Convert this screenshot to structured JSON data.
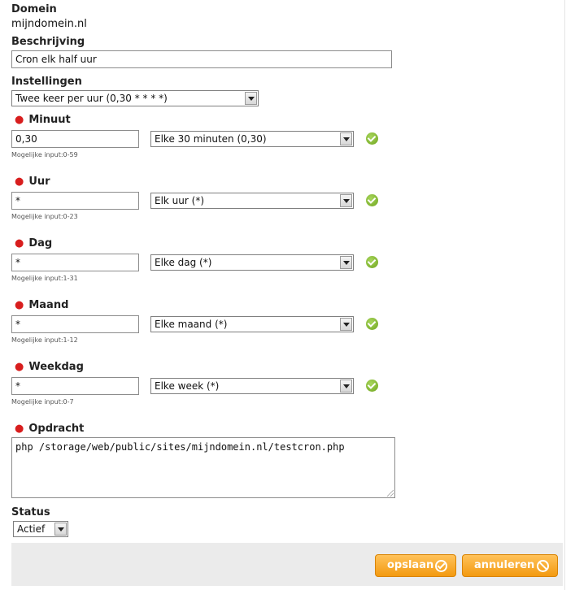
{
  "domain": {
    "label": "Domein",
    "value": "mijndomein.nl"
  },
  "description": {
    "label": "Beschrijving",
    "value": "Cron elk half uur"
  },
  "settings": {
    "label": "Instellingen",
    "selected": "Twee keer per uur (0,30 * * * *)"
  },
  "fields": [
    {
      "label": "Minuut",
      "value": "0,30",
      "option": "Elke 30 minuten (0,30)",
      "hint": "Mogelijke input:0-59"
    },
    {
      "label": "Uur",
      "value": "*",
      "option": "Elk uur (*)",
      "hint": "Mogelijke input:0-23"
    },
    {
      "label": "Dag",
      "value": "*",
      "option": "Elke dag (*)",
      "hint": "Mogelijke input:1-31"
    },
    {
      "label": "Maand",
      "value": "*",
      "option": "Elke maand (*)",
      "hint": "Mogelijke input:1-12"
    },
    {
      "label": "Weekdag",
      "value": "*",
      "option": "Elke week (*)",
      "hint": "Mogelijke input:0-7"
    }
  ],
  "command": {
    "label": "Opdracht",
    "value": "php /storage/web/public/sites/mijndomein.nl/testcron.php"
  },
  "status": {
    "label": "Status",
    "selected": "Actief"
  },
  "buttons": {
    "save": "opslaan",
    "cancel": "annuleren"
  },
  "colors": {
    "accent": "#f39a10",
    "required": "#d81e1e",
    "check": "#6fa51e"
  },
  "icons": {
    "required": "red-dot",
    "valid": "green-check-icon",
    "save": "check-circle-icon",
    "cancel": "forbidden-icon"
  }
}
